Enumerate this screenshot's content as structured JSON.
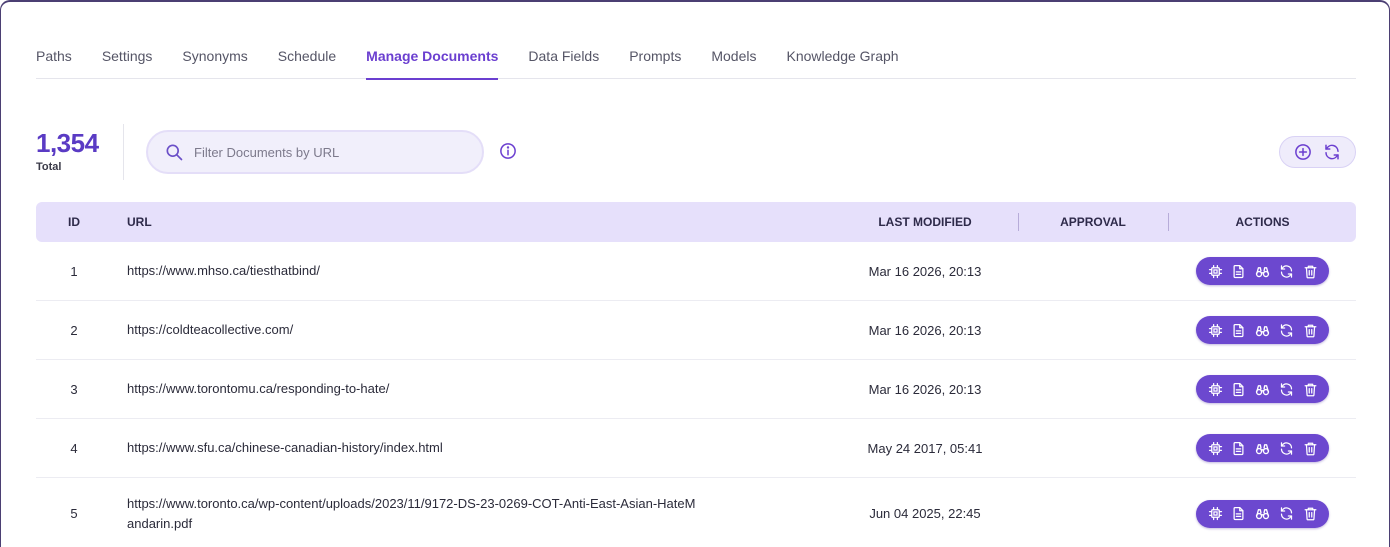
{
  "tabs": [
    {
      "label": "Paths",
      "active": false
    },
    {
      "label": "Settings",
      "active": false
    },
    {
      "label": "Synonyms",
      "active": false
    },
    {
      "label": "Schedule",
      "active": false
    },
    {
      "label": "Manage Documents",
      "active": true
    },
    {
      "label": "Data Fields",
      "active": false
    },
    {
      "label": "Prompts",
      "active": false
    },
    {
      "label": "Models",
      "active": false
    },
    {
      "label": "Knowledge Graph",
      "active": false
    }
  ],
  "stats": {
    "total_count": "1,354",
    "total_label": "Total"
  },
  "search": {
    "placeholder": "Filter Documents by URL",
    "value": "",
    "icon": "search-icon"
  },
  "info": {
    "icon": "info-icon"
  },
  "toolbar": {
    "add_icon": "add-circle-icon",
    "refresh_icon": "refresh-icon"
  },
  "table": {
    "headers": {
      "id": "ID",
      "url": "URL",
      "last_modified": "LAST MODIFIED",
      "approval": "APPROVAL",
      "actions": "ACTIONS"
    },
    "row_action_icons": [
      "chip-icon",
      "document-icon",
      "binoculars-icon",
      "refresh-icon",
      "trash-icon"
    ],
    "rows": [
      {
        "id": "1",
        "url": "https://www.mhso.ca/tiesthatbind/",
        "last_modified": "Mar 16 2026, 20:13",
        "approval": ""
      },
      {
        "id": "2",
        "url": "https://coldteacollective.com/",
        "last_modified": "Mar 16 2026, 20:13",
        "approval": ""
      },
      {
        "id": "3",
        "url": "https://www.torontomu.ca/responding-to-hate/",
        "last_modified": "Mar 16 2026, 20:13",
        "approval": ""
      },
      {
        "id": "4",
        "url": "https://www.sfu.ca/chinese-canadian-history/index.html",
        "last_modified": "May 24 2017, 05:41",
        "approval": ""
      },
      {
        "id": "5",
        "url": "https://www.toronto.ca/wp-content/uploads/2023/11/9172-DS-23-0269-COT-Anti-East-Asian-HateMandarin.pdf",
        "last_modified": "Jun 04 2025, 22:45",
        "approval": ""
      }
    ]
  },
  "colors": {
    "accent": "#6b3fd0",
    "header_bg": "#e6e0fb",
    "action_bg": "#6c48cf"
  }
}
